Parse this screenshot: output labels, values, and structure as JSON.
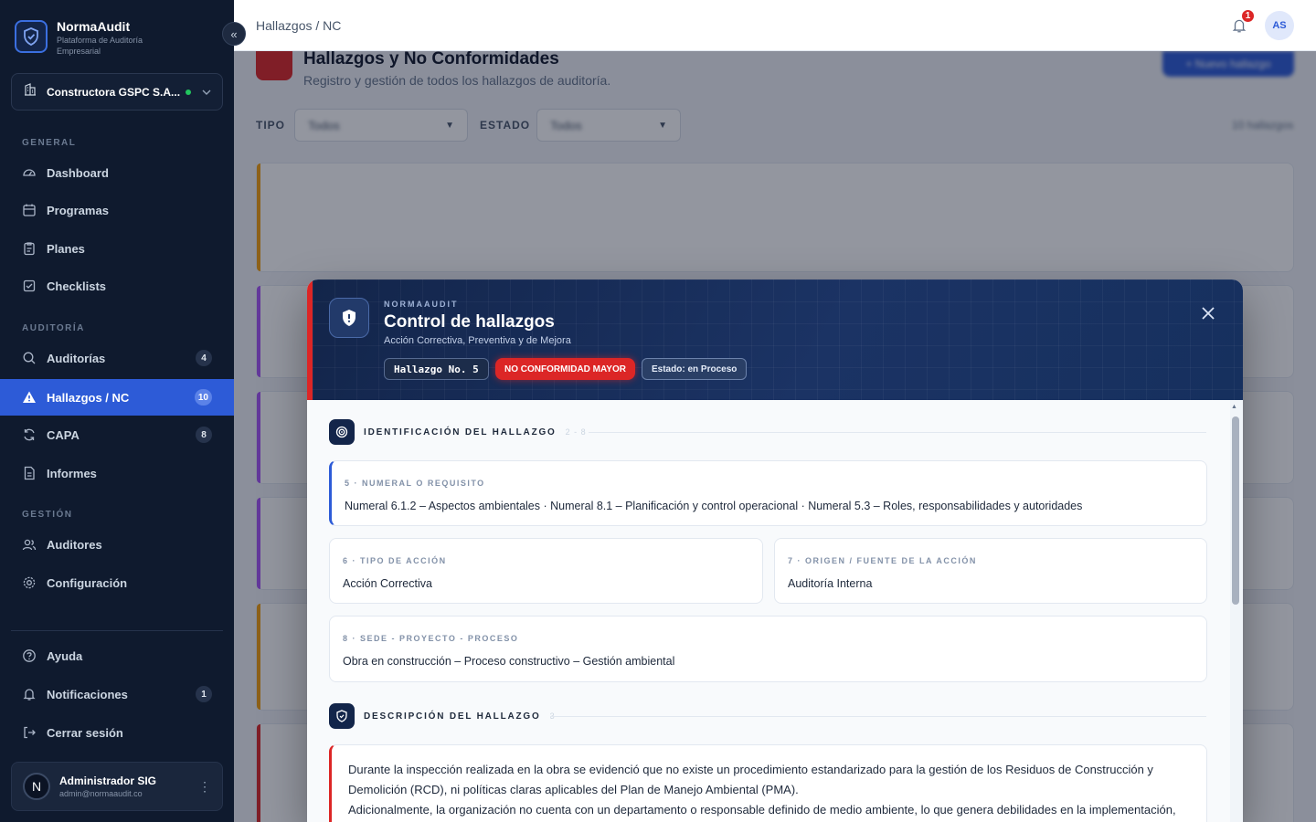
{
  "brand": {
    "name": "NormaAudit",
    "subtitle": "Plataforma de Auditoría Empresarial"
  },
  "org": {
    "name": "Constructora GSPC S.A...",
    "status_color": "#22c55e"
  },
  "sections": {
    "general": "GENERAL",
    "auditoria": "AUDITORÍA",
    "gestion": "GESTIÓN"
  },
  "nav": {
    "dashboard": "Dashboard",
    "programas": "Programas",
    "planes": "Planes",
    "checklists": "Checklists",
    "auditorias": {
      "label": "Auditorías",
      "badge": "4"
    },
    "hallazgos": {
      "label": "Hallazgos / NC",
      "badge": "10"
    },
    "capa": {
      "label": "CAPA",
      "badge": "8"
    },
    "informes": "Informes",
    "auditores": "Auditores",
    "configuracion": "Configuración",
    "ayuda": "Ayuda",
    "notificaciones": {
      "label": "Notificaciones",
      "badge": "1"
    },
    "cerrar": "Cerrar sesión"
  },
  "user": {
    "initial": "N",
    "name": "Administrador SIG",
    "email": "admin@normaaudit.co"
  },
  "topbar": {
    "breadcrumb": "Hallazgos / NC",
    "notif_count": "1",
    "avatar": "AS"
  },
  "page": {
    "title": "Hallazgos y No Conformidades",
    "subtitle": "Registro y gestión de todos los hallazgos de auditoría.",
    "new_button": "+ Nuevo hallazgo",
    "filter_tipo_label": "TIPO",
    "filter_tipo_value": "Todos",
    "filter_estado_label": "ESTADO",
    "filter_estado_value": "Todos",
    "count": "10 hallazgos"
  },
  "modal": {
    "kicker": "NORMAAUDIT",
    "title": "Control de hallazgos",
    "subtitle": "Acción Correctiva, Preventiva y de Mejora",
    "chip_number": "Hallazgo No. 5",
    "chip_type": "NO CONFORMIDAD MAYOR",
    "chip_state": "Estado: en Proceso",
    "section1": {
      "title": "IDENTIFICACIÓN DEL HALLAZGO",
      "range": "2 - 8"
    },
    "numeral": {
      "label": "5 · NUMERAL O REQUISITO",
      "value": "Numeral 6.1.2 – Aspectos ambientales · Numeral 8.1 – Planificación y control operacional · Numeral 5.3 – Roles, responsabilidades y autoridades"
    },
    "tipo_accion": {
      "label": "6 · TIPO DE ACCIÓN",
      "value": "Acción Correctiva"
    },
    "origen": {
      "label": "7 · ORIGEN / FUENTE DE LA ACCIÓN",
      "value": "Auditoría Interna"
    },
    "sede": {
      "label": "8 · SEDE - PROYECTO - PROCESO",
      "value": "Obra en construcción – Proceso constructivo – Gestión ambiental"
    },
    "section2": {
      "title": "DESCRIPCIÓN DEL HALLAZGO",
      "range": "3"
    },
    "description_p1": "Durante la inspección realizada en la obra se evidenció que no existe un procedimiento estandarizado para la gestión de los Residuos de Construcción y Demolición (RCD), ni políticas claras aplicables del Plan de Manejo Ambiental (PMA).",
    "description_p2": "Adicionalmente, la organización no cuenta con un departamento o responsable definido de medio ambiente, lo que genera debilidades en la implementación, seguimiento y control de las disposiciones ambientales en la obra."
  }
}
